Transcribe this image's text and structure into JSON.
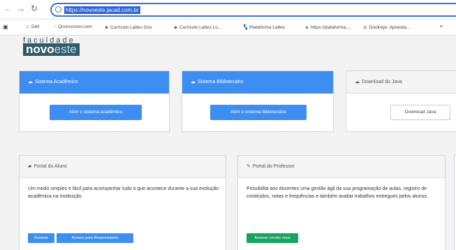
{
  "browser": {
    "back": "←",
    "forward": "→",
    "reload": "↻",
    "url": "https://novoeste.jacad.com.br"
  },
  "bookmarks": [
    {
      "icon": "□",
      "label": "Dell",
      "color": "#555"
    },
    {
      "icon": "◔",
      "label": "Qconcursos.com",
      "color": "#f06a1c"
    },
    {
      "icon": "◆",
      "label": "Currículo Lattes Gov",
      "color": "#5a8a2f"
    },
    {
      "icon": "◆",
      "label": "Currículo Lattes Lo...",
      "color": "#5a8a2f"
    },
    {
      "icon": "▚",
      "label": "Plataforma Lattes",
      "color": "#2a6ec1"
    },
    {
      "icon": "◈",
      "label": "https://plataforma....",
      "color": "#2a6ec1"
    },
    {
      "icon": "◎",
      "label": "Duolingo: Aprenda...",
      "color": "#555"
    },
    {
      "icon": "≡",
      "label": "",
      "color": "#555"
    }
  ],
  "logo": {
    "top": "faculdade",
    "part1": "novo",
    "part2": "este"
  },
  "cards": {
    "academic": {
      "title": "Sistema Acadêmico",
      "button": "Abrir o sistema acadêmico"
    },
    "library": {
      "title": "Sistema Bibliotecário",
      "button": "Abrir o sistema bibliotecário"
    },
    "java": {
      "title": "Download do Java",
      "button": "Download Java"
    },
    "student": {
      "title": "Portal do Aluno",
      "text": "Um modo simples e fácil para acompanhar tudo o que acontece durante a sua evolução acadêmica na instituição.",
      "btn1": "Acessar",
      "btn2": "Acesso para Responsáveis"
    },
    "teacher": {
      "title": "Portal do Professor",
      "text": "Possibilita aos docentes uma gestão ágil da sua programação de aulas, registro de conteúdos, notas e frequências e também avaliar trabalhos entregues pelos alunos.",
      "btn1": "Acessar versão nova"
    }
  },
  "colors": {
    "accent": "#3e8ef2",
    "green": "#18a363"
  }
}
